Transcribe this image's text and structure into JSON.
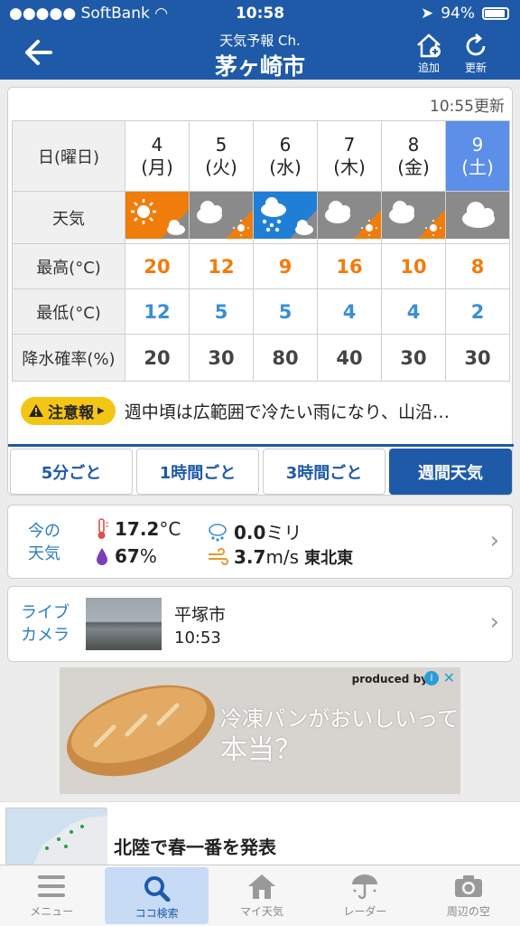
{
  "status": {
    "carrier": "SoftBank",
    "time": "10:58",
    "battery": "94%"
  },
  "nav": {
    "subtitle": "天気予報 Ch.",
    "title": "茅ヶ崎市",
    "add_label": "追加",
    "refresh_label": "更新"
  },
  "weekly": {
    "updated": "10:55更新",
    "headers": {
      "day": "日(曜日)",
      "weather": "天気",
      "high": "最高(°C)",
      "low": "最低(°C)",
      "precip": "降水確率(%)"
    },
    "days": [
      {
        "date": "4",
        "dow": "(月)",
        "high": "20",
        "low": "12",
        "precip": "20",
        "icon": "sunny-then-cloudy-icon"
      },
      {
        "date": "5",
        "dow": "(火)",
        "high": "12",
        "low": "5",
        "precip": "30",
        "icon": "cloudy-then-sunny-icon"
      },
      {
        "date": "6",
        "dow": "(水)",
        "high": "9",
        "low": "5",
        "precip": "80",
        "icon": "rain-then-cloudy-icon"
      },
      {
        "date": "7",
        "dow": "(木)",
        "high": "16",
        "low": "4",
        "precip": "40",
        "icon": "cloudy-then-sunny-icon"
      },
      {
        "date": "8",
        "dow": "(金)",
        "high": "10",
        "low": "4",
        "precip": "30",
        "icon": "cloudy-then-sunny-icon"
      },
      {
        "date": "9",
        "dow": "(土)",
        "high": "8",
        "low": "2",
        "precip": "30",
        "icon": "cloudy-icon"
      }
    ],
    "alert_badge": "注意報",
    "alert_text": "週中頃は広範囲で冷たい雨になり、山沿…"
  },
  "tabs": [
    "5分ごと",
    "1時間ごと",
    "3時間ごと",
    "週間天気"
  ],
  "current": {
    "label_line1": "今の",
    "label_line2": "天気",
    "temp_value": "17.2",
    "temp_unit": "°C",
    "rain_value": "0.0",
    "rain_unit": "ミリ",
    "humidity_value": "67",
    "humidity_unit": "%",
    "wind_value": "3.7",
    "wind_unit": "m/s",
    "wind_dir": "東北東"
  },
  "camera": {
    "label_line1": "ライブ",
    "label_line2": "カメラ",
    "place": "平塚市",
    "time": "10:53"
  },
  "ad": {
    "produced_by": "produced by",
    "copy_line1": "冷凍パンがおいしいって",
    "copy_line2": "本当？"
  },
  "news": {
    "headline": "北陸で春一番を発表"
  },
  "bottom_nav": [
    {
      "label": "メニュー",
      "icon": "menu-icon"
    },
    {
      "label": "ココ検索",
      "icon": "search-icon"
    },
    {
      "label": "マイ天気",
      "icon": "home-icon"
    },
    {
      "label": "レーダー",
      "icon": "radar-umbrella-icon"
    },
    {
      "label": "周辺の空",
      "icon": "camera-icon"
    }
  ],
  "colors": {
    "brand": "#1e5aa8",
    "high": "#f27b0b",
    "low": "#3a8fd6",
    "sunny_bg": "#f07d0b",
    "rain_bg": "#1f7fd6",
    "cloudy_bg": "#8a8a8a"
  }
}
